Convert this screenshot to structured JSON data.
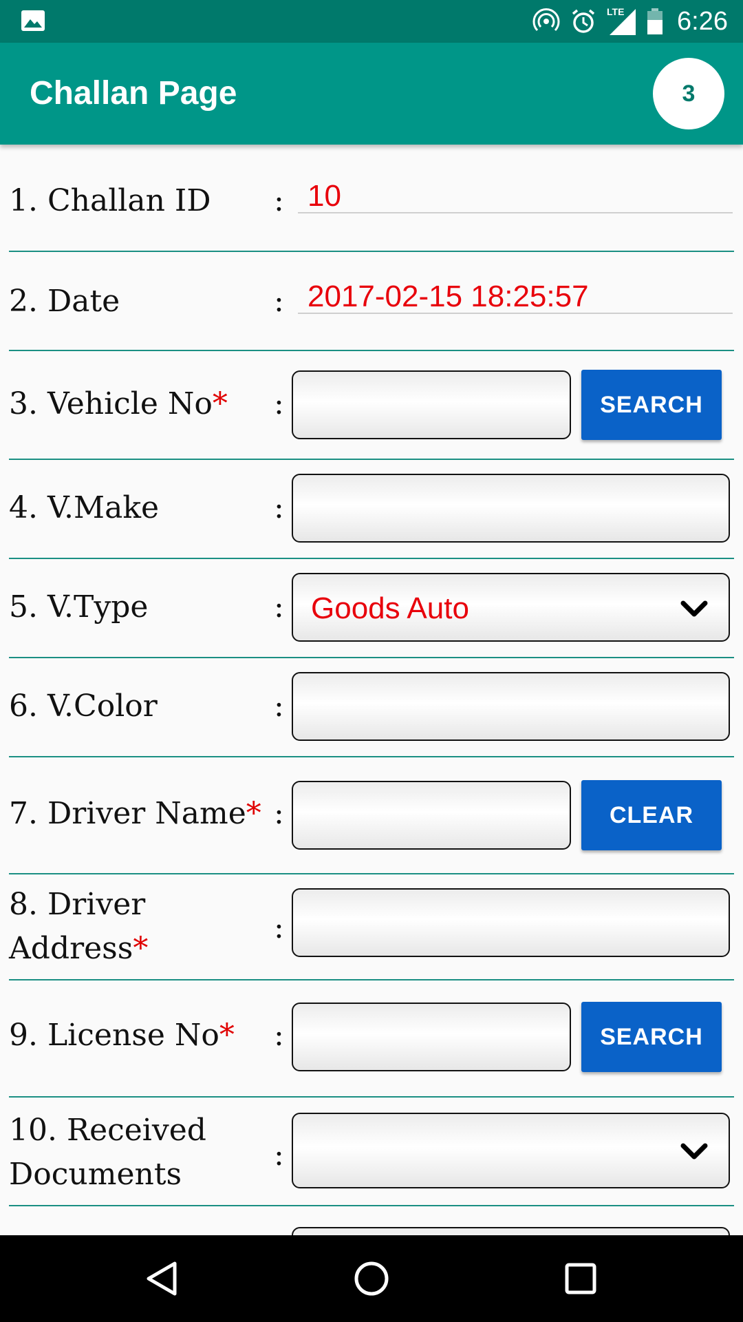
{
  "status_bar": {
    "time": "6:26",
    "network": "LTE",
    "icons": [
      "image-icon",
      "hotspot-icon",
      "alarm-icon",
      "signal-icon",
      "battery-icon"
    ]
  },
  "app_bar": {
    "title": "Challan Page",
    "badge": "3",
    "color": "#009688"
  },
  "form": {
    "challan_id": {
      "label": "1. Challan ID",
      "value": "10"
    },
    "date": {
      "label": "2. Date",
      "value": "2017-02-15 18:25:57"
    },
    "vehicle_no": {
      "label": "3. Vehicle No",
      "required": "*",
      "value": "",
      "button": "SEARCH"
    },
    "v_make": {
      "label": "4. V.Make",
      "value": ""
    },
    "v_type": {
      "label": "5. V.Type",
      "value": "Goods Auto"
    },
    "v_color": {
      "label": "6. V.Color",
      "value": ""
    },
    "driver_name": {
      "label": "7. Driver Name",
      "required": "*",
      "value": "",
      "button": "CLEAR"
    },
    "driver_address": {
      "label_line1": "8. Driver",
      "label_line2": "Address",
      "required": "*",
      "value": ""
    },
    "license_no": {
      "label": "9. License No",
      "required": "*",
      "value": "",
      "button": "SEARCH"
    },
    "received_documents": {
      "label_line1": "10. Received",
      "label_line2": "Documents",
      "value": ""
    },
    "colon": ":",
    "accent_color": "#e8000b",
    "button_color": "#0a62c8"
  }
}
